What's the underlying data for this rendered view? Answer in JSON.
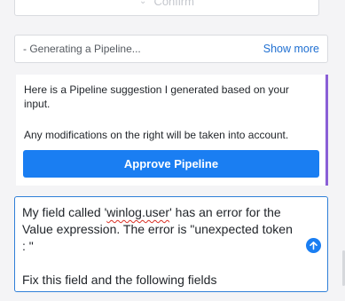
{
  "confirm_button": {
    "label": "Confirm",
    "icon": "chevron-down-icon"
  },
  "status_bar": {
    "text": "- Generating a Pipeline...",
    "show_more_label": "Show more"
  },
  "suggestion_card": {
    "line1": "Here is a Pipeline suggestion I generated based on your",
    "line2": "input.",
    "line3": "Any modifications on the right will be taken into account.",
    "approve_label": "Approve Pipeline",
    "accent_color": "#8a5fd6"
  },
  "message_input": {
    "line1_pre": "My field called '",
    "line1_spell": "winlog.user",
    "line1_post": "' has an error for the",
    "line2": "Value expression. The error is \"unexpected token",
    "line3": ": \"",
    "line4": "Fix this field and the following fields",
    "send_icon": "arrow-up-circle-icon"
  },
  "colors": {
    "primary": "#1a7ef2",
    "link": "#1f6fd1",
    "input_border": "#2f7fd8"
  }
}
